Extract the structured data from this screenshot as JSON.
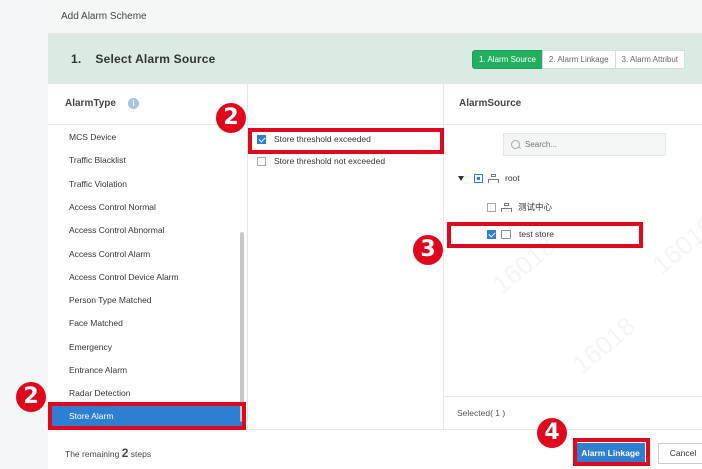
{
  "dialog": {
    "title": "Add Alarm Scheme",
    "step_number": "1.",
    "step_title": "Select Alarm Source",
    "steps": [
      "1. Alarm Source",
      "2. Alarm Linkage",
      "3. Alarm Attribut"
    ]
  },
  "alarm_type": {
    "header": "AlarmType",
    "info_icon": "info-icon",
    "items": [
      "MCS Device",
      "Traffic Blacklist",
      "Traffic Violation",
      "Access Control Normal",
      "Access Control Abnormal",
      "Access Control Alarm",
      "Access Control Device Alarm",
      "Person Type Matched",
      "Face Matched",
      "Emergency",
      "Entrance Alarm",
      "Radar Detection",
      "Store Alarm"
    ],
    "selected": "Store Alarm"
  },
  "conditions": {
    "items": [
      {
        "label": "Store threshold exceeded",
        "checked": true
      },
      {
        "label": "Store threshold not exceeded",
        "checked": false
      }
    ]
  },
  "alarm_source": {
    "header": "AlarmSource",
    "search_placeholder": "Search...",
    "tree": {
      "root_label": "root",
      "child_org_label": "测试中心",
      "store_label": "test store"
    },
    "selected_text": "Selected( 1 )"
  },
  "footer": {
    "remaining_prefix": "The remaining",
    "remaining_count": "2",
    "remaining_suffix": "steps",
    "linkage_button": "Alarm Linkage",
    "cancel_button": "Cancel"
  },
  "annotations": {
    "badge_2": "2",
    "badge_3": "3",
    "badge_4": "4",
    "highlight_color": "#e0081c"
  },
  "colors": {
    "accent_blue": "#2e7fd2",
    "step_active_green": "#22b060",
    "step_bar_bg": "#d9ebe3"
  }
}
